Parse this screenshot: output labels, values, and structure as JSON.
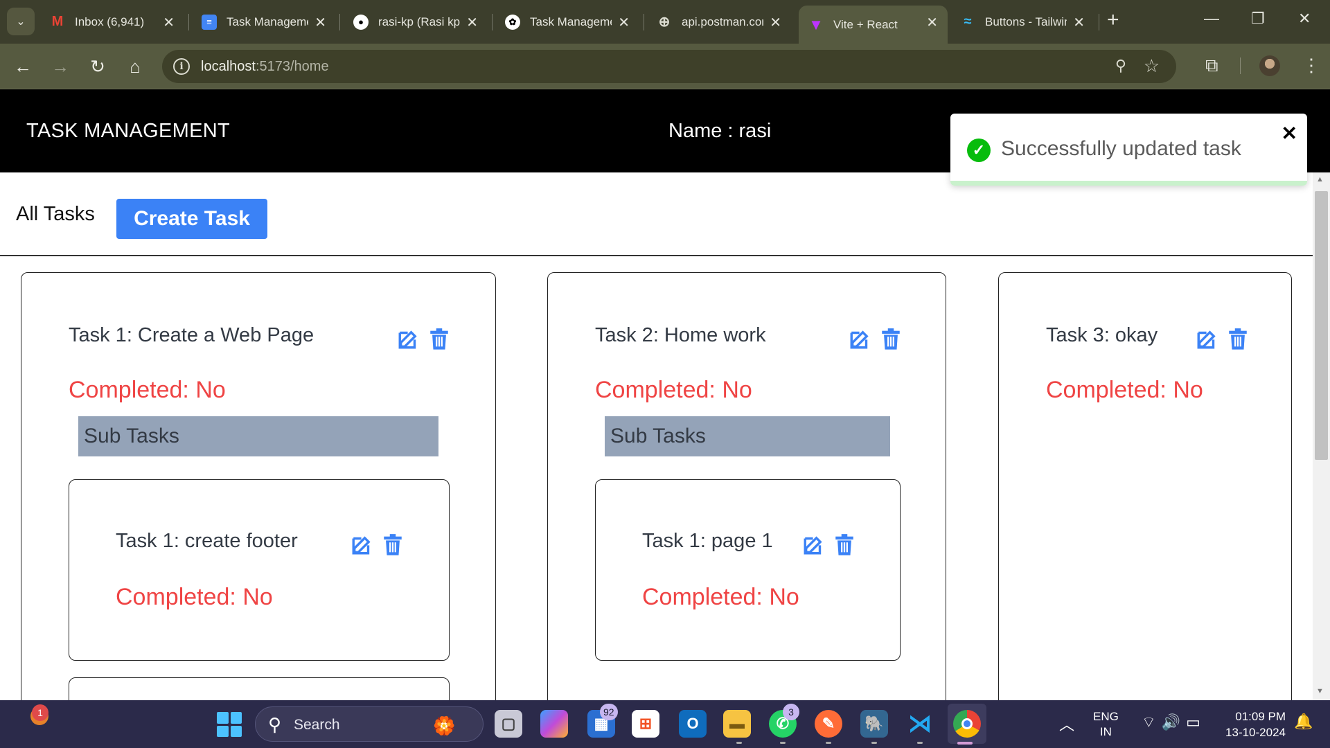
{
  "browser": {
    "tabs": [
      {
        "title": "Inbox (6,941)",
        "icon": "gmail-icon"
      },
      {
        "title": "Task Management",
        "icon": "docs-icon"
      },
      {
        "title": "rasi-kp (Rasi kp)",
        "icon": "github-icon"
      },
      {
        "title": "Task Management",
        "icon": "chatgpt-icon"
      },
      {
        "title": "api.postman.com",
        "icon": "globe-icon"
      },
      {
        "title": "Vite + React",
        "icon": "vite-icon",
        "active": true
      },
      {
        "title": "Buttons - Tailwind",
        "icon": "tailwind-icon"
      }
    ],
    "url_host": "localhost",
    "url_rest": ":5173/home"
  },
  "app": {
    "title": "TASK MANAGEMENT",
    "user_label": "Name : rasi"
  },
  "toast": {
    "message": "Successfully updated task",
    "type": "success"
  },
  "page": {
    "heading": "All Tasks",
    "create_button": "Create Task",
    "subtasks_label": "Sub Tasks"
  },
  "tasks": [
    {
      "title": "Task 1: Create a Web Page",
      "status": "Completed: No",
      "subtasks": [
        {
          "title": "Task 1: create footer",
          "status": "Completed: No"
        }
      ]
    },
    {
      "title": "Task 2: Home work",
      "status": "Completed: No",
      "subtasks": [
        {
          "title": "Task 1: page 1",
          "status": "Completed: No"
        }
      ]
    },
    {
      "title": "Task 3: okay",
      "status": "Completed: No",
      "subtasks": []
    }
  ],
  "taskbar": {
    "widget_badge": "1",
    "search_label": "Search",
    "teams_badge": "92",
    "whatsapp_badge": "3",
    "lang_top": "ENG",
    "lang_bottom": "IN",
    "time": "01:09 PM",
    "date": "13-10-2024"
  },
  "colors": {
    "header_bg": "#000000",
    "primary_button": "#3b82f6",
    "status_red": "#ef4444",
    "subtasks_bar": "#94a3b8",
    "icon_blue": "#3b82f6",
    "toast_success": "#07bc0c"
  }
}
